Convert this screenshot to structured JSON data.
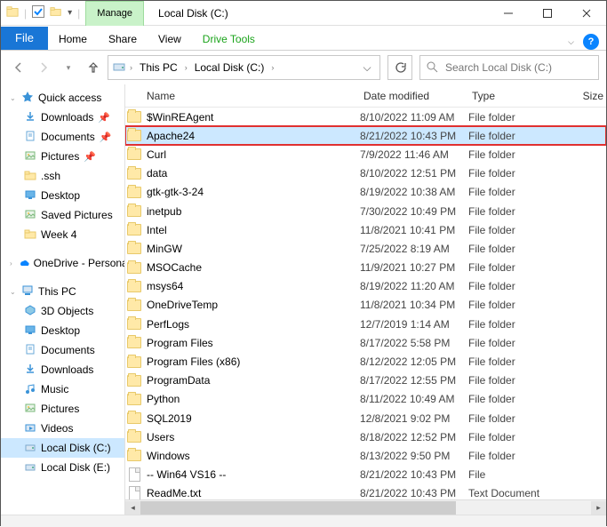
{
  "window": {
    "title": "Local Disk (C:)",
    "contextTab": "Manage",
    "contextSub": "Drive Tools"
  },
  "ribbon": {
    "file": "File",
    "tabs": [
      "Home",
      "Share",
      "View"
    ]
  },
  "address": {
    "root": "This PC",
    "segments": [
      "Local Disk (C:)"
    ]
  },
  "search": {
    "placeholder": "Search Local Disk (C:)"
  },
  "sidebar": {
    "groups": [
      {
        "label": "Quick access",
        "icon": "star",
        "accent": "#3a93d8",
        "expand": true,
        "children": [
          {
            "label": "Downloads",
            "icon": "down",
            "pinned": true
          },
          {
            "label": "Documents",
            "icon": "doc",
            "pinned": true
          },
          {
            "label": "Pictures",
            "icon": "pic",
            "pinned": true
          },
          {
            "label": ".ssh",
            "icon": "folder"
          },
          {
            "label": "Desktop",
            "icon": "desktop"
          },
          {
            "label": "Saved Pictures",
            "icon": "pic"
          },
          {
            "label": "Week 4",
            "icon": "folder"
          }
        ]
      },
      {
        "label": "OneDrive - Personal",
        "icon": "cloud",
        "accent": "#0a84ff",
        "expand": false,
        "children": []
      },
      {
        "label": "This PC",
        "icon": "pc",
        "accent": "#3a93d8",
        "expand": true,
        "children": [
          {
            "label": "3D Objects",
            "icon": "3d"
          },
          {
            "label": "Desktop",
            "icon": "desktop"
          },
          {
            "label": "Documents",
            "icon": "doc"
          },
          {
            "label": "Downloads",
            "icon": "down"
          },
          {
            "label": "Music",
            "icon": "music"
          },
          {
            "label": "Pictures",
            "icon": "pic"
          },
          {
            "label": "Videos",
            "icon": "video"
          },
          {
            "label": "Local Disk (C:)",
            "icon": "disk",
            "selected": true
          },
          {
            "label": "Local Disk (E:)",
            "icon": "disk"
          }
        ]
      }
    ]
  },
  "columns": {
    "name": "Name",
    "date": "Date modified",
    "type": "Type",
    "size": "Size"
  },
  "files": [
    {
      "name": "$WinREAgent",
      "date": "8/10/2022 11:09 AM",
      "type": "File folder",
      "icon": "folder"
    },
    {
      "name": "Apache24",
      "date": "8/21/2022 10:43 PM",
      "type": "File folder",
      "icon": "folder",
      "selected": true,
      "highlight": true
    },
    {
      "name": "Curl",
      "date": "7/9/2022 11:46 AM",
      "type": "File folder",
      "icon": "folder"
    },
    {
      "name": "data",
      "date": "8/10/2022 12:51 PM",
      "type": "File folder",
      "icon": "folder"
    },
    {
      "name": "gtk-gtk-3-24",
      "date": "8/19/2022 10:38 AM",
      "type": "File folder",
      "icon": "folder"
    },
    {
      "name": "inetpub",
      "date": "7/30/2022 10:49 PM",
      "type": "File folder",
      "icon": "folder"
    },
    {
      "name": "Intel",
      "date": "11/8/2021 10:41 PM",
      "type": "File folder",
      "icon": "folder"
    },
    {
      "name": "MinGW",
      "date": "7/25/2022 8:19 AM",
      "type": "File folder",
      "icon": "folder"
    },
    {
      "name": "MSOCache",
      "date": "11/9/2021 10:27 PM",
      "type": "File folder",
      "icon": "folder"
    },
    {
      "name": "msys64",
      "date": "8/19/2022 11:20 AM",
      "type": "File folder",
      "icon": "folder"
    },
    {
      "name": "OneDriveTemp",
      "date": "11/8/2021 10:34 PM",
      "type": "File folder",
      "icon": "folder"
    },
    {
      "name": "PerfLogs",
      "date": "12/7/2019 1:14 AM",
      "type": "File folder",
      "icon": "folder"
    },
    {
      "name": "Program Files",
      "date": "8/17/2022 5:58 PM",
      "type": "File folder",
      "icon": "folder"
    },
    {
      "name": "Program Files (x86)",
      "date": "8/12/2022 12:05 PM",
      "type": "File folder",
      "icon": "folder"
    },
    {
      "name": "ProgramData",
      "date": "8/17/2022 12:55 PM",
      "type": "File folder",
      "icon": "folder"
    },
    {
      "name": "Python",
      "date": "8/11/2022 10:49 AM",
      "type": "File folder",
      "icon": "folder"
    },
    {
      "name": "SQL2019",
      "date": "12/8/2021 9:02 PM",
      "type": "File folder",
      "icon": "folder"
    },
    {
      "name": "Users",
      "date": "8/18/2022 12:52 PM",
      "type": "File folder",
      "icon": "folder"
    },
    {
      "name": "Windows",
      "date": "8/13/2022 9:50 PM",
      "type": "File folder",
      "icon": "folder"
    },
    {
      "name": "-- Win64 VS16  --",
      "date": "8/21/2022 10:43 PM",
      "type": "File",
      "icon": "file"
    },
    {
      "name": "ReadMe.txt",
      "date": "8/21/2022 10:43 PM",
      "type": "Text Document",
      "icon": "file"
    }
  ]
}
